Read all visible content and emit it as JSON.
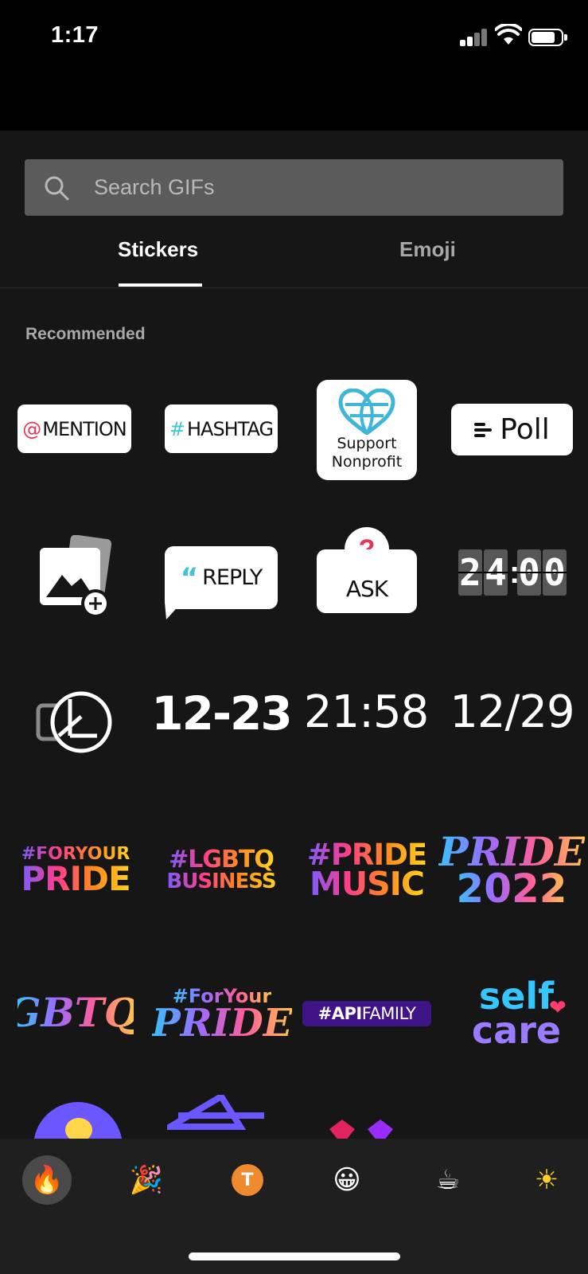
{
  "status_bar": {
    "time": "1:17"
  },
  "search": {
    "placeholder": "Search GIFs"
  },
  "tabs": [
    {
      "label": "Stickers",
      "active": true
    },
    {
      "label": "Emoji",
      "active": false
    }
  ],
  "section": {
    "title": "Recommended"
  },
  "stickers": {
    "mention": {
      "symbol": "@",
      "label": "MENTION"
    },
    "hashtag": {
      "symbol": "#",
      "label": "HASHTAG"
    },
    "support": {
      "line1": "Support",
      "line2": "Nonprofit"
    },
    "poll": {
      "label": "Poll"
    },
    "reply": {
      "quote": "“",
      "label": "REPLY"
    },
    "ask": {
      "mark": "?",
      "label": "ASK"
    },
    "clock": {
      "d1": "2",
      "d2": "4",
      "d3": "0",
      "d4": "0"
    },
    "date_bold": "12-23",
    "time_light": "21:58",
    "date_slash": "12/29",
    "foryour_pride": {
      "line1": "#FORYOUR",
      "line2": "PRIDE"
    },
    "lgbtq_business": {
      "line1": "#LGBTQ",
      "line2": "BUSINESS"
    },
    "pride_music": {
      "line1": "#PRIDE",
      "line2": "MUSIC"
    },
    "pride_2022": {
      "line1": "PRIDE",
      "line2": "2022"
    },
    "lgbtq_plus": "LGBTQ+",
    "foryour_pride_script": {
      "line1": "#ForYour",
      "line2": "PRIDE"
    },
    "apifamily": {
      "bold": "#API",
      "rest": "FAMILY"
    },
    "selfcare": {
      "line1": "self",
      "line2": "care"
    }
  },
  "categories": [
    {
      "icon": "fire-icon",
      "glyph": "🔥",
      "active": true
    },
    {
      "icon": "party-popper-icon",
      "glyph": "🎉",
      "active": false
    },
    {
      "icon": "text-t-icon",
      "glyph": "T",
      "active": false
    },
    {
      "icon": "grinning-face-icon",
      "glyph": "😀",
      "active": false
    },
    {
      "icon": "coffee-icon",
      "glyph": "☕",
      "active": false
    },
    {
      "icon": "sun-icon",
      "glyph": "☀",
      "active": false
    }
  ],
  "colors": {
    "accent_red": "#e8365a",
    "accent_cyan": "#3ec4d8",
    "panel_bg": "#161616"
  }
}
